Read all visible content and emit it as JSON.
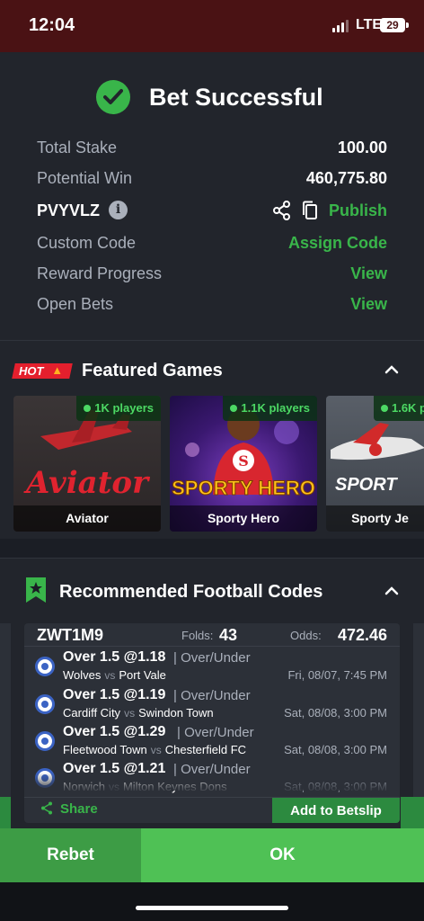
{
  "status_bar": {
    "time": "12:04",
    "network": "LTE",
    "battery": "29"
  },
  "confirmation": {
    "title": "Bet Successful",
    "total_stake_label": "Total Stake",
    "total_stake_value": "100.00",
    "potential_win_label": "Potential Win",
    "potential_win_value": "460,775.80",
    "booking_code": "PVYVLZ",
    "publish_label": "Publish",
    "custom_code_label": "Custom Code",
    "assign_code_label": "Assign Code",
    "reward_progress_label": "Reward Progress",
    "reward_view_label": "View",
    "open_bets_label": "Open Bets",
    "open_bets_view_label": "View"
  },
  "featured": {
    "badge": "HOT",
    "title": "Featured Games",
    "games": [
      {
        "name": "Aviator",
        "players": "1K players",
        "art_text": "Aviator"
      },
      {
        "name": "Sporty Hero",
        "players": "1.1K players",
        "art_text": "SPORTY HERO"
      },
      {
        "name": "Sporty Je",
        "players": "1.6K p",
        "art_text": "SPORT"
      }
    ]
  },
  "recommended": {
    "title": "Recommended Football Codes",
    "code": "ZWT1M9",
    "folds_label": "Folds:",
    "folds_value": "43",
    "odds_label": "Odds:",
    "odds_value": "472.46",
    "selections": [
      {
        "pick": "Over 1.5 @1.18",
        "market": "| Over/Under",
        "home": "Wolves",
        "vs": "vs",
        "away": "Port Vale",
        "when": "Fri, 08/07, 7:45 PM"
      },
      {
        "pick": "Over 1.5 @1.19",
        "market": "| Over/Under",
        "home": "Cardiff City",
        "vs": "vs",
        "away": "Swindon Town",
        "when": "Sat, 08/08, 3:00 PM"
      },
      {
        "pick": "Over 1.5 @1.29",
        "market": "| Over/Under",
        "home": "Fleetwood Town",
        "vs": "vs",
        "away": "Chesterfield FC",
        "when": "Sat, 08/08, 3:00 PM"
      },
      {
        "pick": "Over 1.5 @1.21",
        "market": "| Over/Under",
        "home": "Norwich",
        "vs": "vs",
        "away": "Milton Keynes Dons",
        "when": "Sat, 08/08, 3:00 PM"
      }
    ],
    "share_label": "Share",
    "add_betslip_label": "Add to Betslip"
  },
  "actions": {
    "rebet_label": "Rebet",
    "ok_label": "OK"
  },
  "colors": {
    "accent_green": "#39b54a",
    "status_bar": "#4a1214",
    "hot_red": "#e41f2d"
  }
}
